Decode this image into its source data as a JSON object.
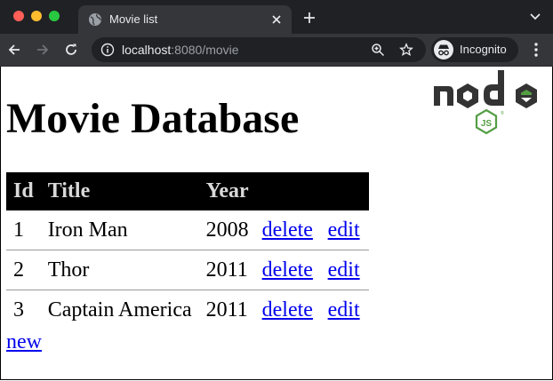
{
  "browser": {
    "tab_title": "Movie list",
    "url_host": "localhost",
    "url_rest": ":8080/movie",
    "profile_label": "Incognito"
  },
  "page": {
    "title": "Movie Database",
    "logo_icon": "nodejs-logo-icon",
    "table": {
      "headers": {
        "id": "Id",
        "title": "Title",
        "year": "Year"
      },
      "rows": [
        {
          "id": "1",
          "title": "Iron Man",
          "year": "2008",
          "delete": "delete",
          "edit": "edit"
        },
        {
          "id": "2",
          "title": "Thor",
          "year": "2011",
          "delete": "delete",
          "edit": "edit"
        },
        {
          "id": "3",
          "title": "Captain America",
          "year": "2011",
          "delete": "delete",
          "edit": "edit"
        }
      ]
    },
    "new_link": "new"
  },
  "colors": {
    "link": "#0000ee",
    "header_bg": "#000000",
    "header_text": "#d9d9d9",
    "chrome_dark": "#202124",
    "chrome_tab": "#35363a",
    "node_green": "#539e43",
    "node_dark": "#333333"
  }
}
